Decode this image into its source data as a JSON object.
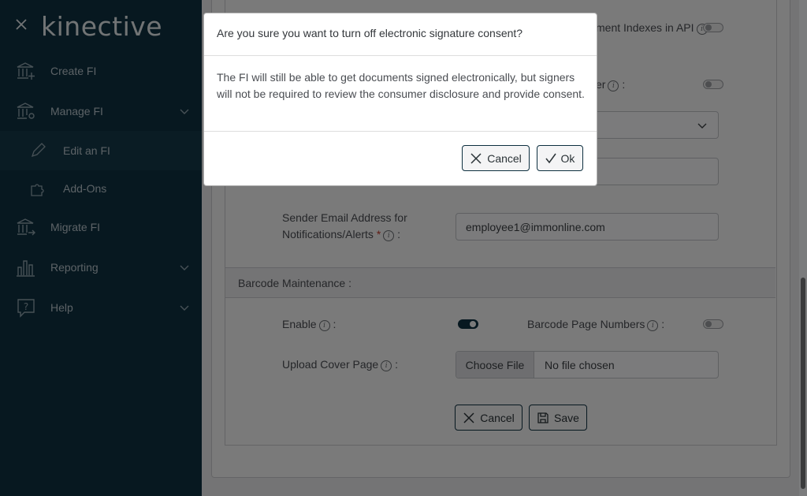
{
  "sidebar": {
    "logo": "kinective",
    "items": [
      {
        "label": "Create FI"
      },
      {
        "label": "Manage FI"
      },
      {
        "label": "Edit an FI"
      },
      {
        "label": "Add-Ons"
      },
      {
        "label": "Migrate FI"
      },
      {
        "label": "Reporting"
      },
      {
        "label": "Help"
      }
    ]
  },
  "form": {
    "api_indexes_label": "ment Indexes in API",
    "partial_label_er": "er",
    "sender_email_label_line1": "Sender Email Address for",
    "sender_email_label_line2": "Notifications/Alerts",
    "sender_email_value": "employee1@immonline.com",
    "barcode_section_title": "Barcode Maintenance :",
    "enable_label": "Enable",
    "barcode_page_numbers_label": "Barcode Page Numbers",
    "upload_cover_label": "Upload Cover Page",
    "choose_file_label": "Choose File",
    "no_file_label": "No file chosen",
    "cancel_label": "Cancel",
    "save_label": "Save",
    "enable_on": true,
    "barcode_page_numbers_on": false
  },
  "modal": {
    "title": "Are you sure you want to turn off electronic signature consent?",
    "body": "The FI will still be able to get documents signed electronically, but signers will not be required to review the consumer disclosure and provide consent.",
    "cancel_label": "Cancel",
    "ok_label": "Ok"
  },
  "colors": {
    "sidebar_bg": "#0e3040",
    "accent": "#0e3040"
  }
}
